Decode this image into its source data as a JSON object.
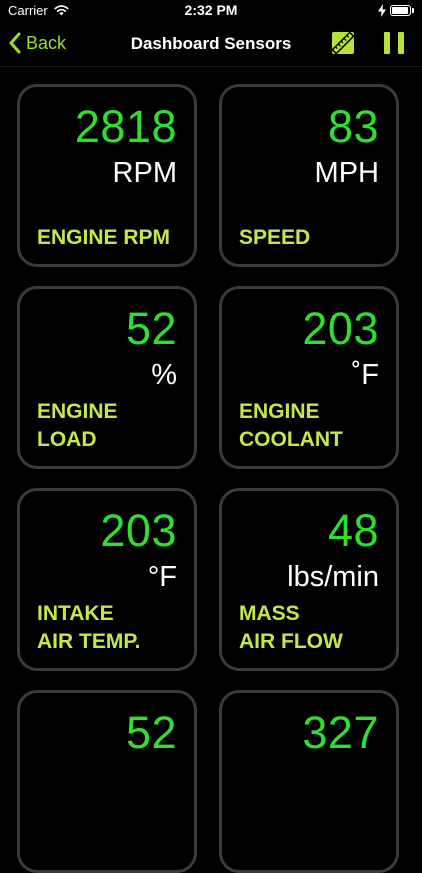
{
  "status_bar": {
    "carrier": "Carrier",
    "time": "2:32 PM"
  },
  "nav": {
    "back_label": "Back",
    "title": "Dashboard Sensors"
  },
  "colors": {
    "accent": "#9be01f",
    "value_green": "#2ee02e",
    "label_green": "#c2e94a",
    "tile_border": "#3a3a3a",
    "background": "#000000"
  },
  "sensors": [
    {
      "value": "2818",
      "unit": "RPM",
      "label": "ENGINE RPM"
    },
    {
      "value": "83",
      "unit": "MPH",
      "label": "SPEED"
    },
    {
      "value": "52",
      "unit": "%",
      "label": "ENGINE\nLOAD"
    },
    {
      "value": "203",
      "unit": "˚F",
      "label": "ENGINE\nCOOLANT"
    },
    {
      "value": "203",
      "unit": "°F",
      "label": "INTAKE\nAIR TEMP."
    },
    {
      "value": "48",
      "unit": "lbs/min",
      "label": "MASS\nAIR FLOW"
    },
    {
      "value": "52",
      "unit": "",
      "label": ""
    },
    {
      "value": "327",
      "unit": "",
      "label": ""
    }
  ]
}
